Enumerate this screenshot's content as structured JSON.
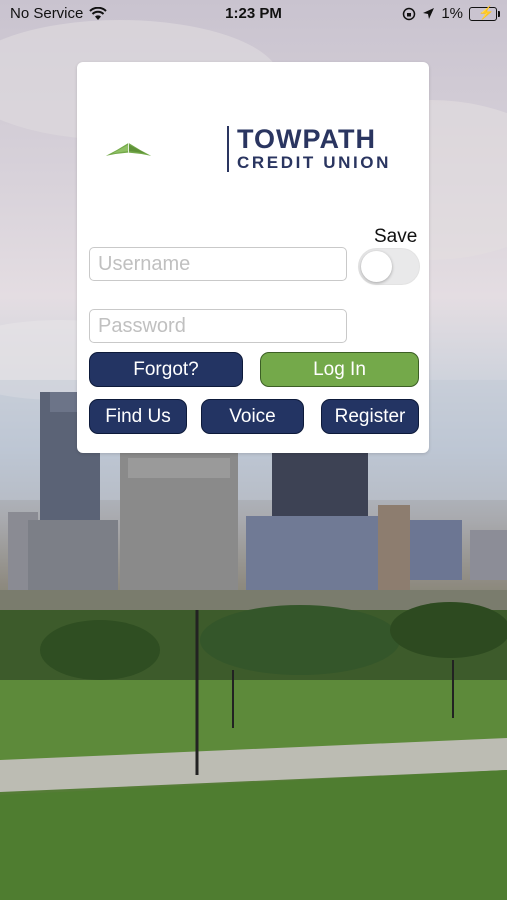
{
  "status_bar": {
    "carrier": "No Service",
    "time": "1:23 PM",
    "battery_percent": "1%",
    "icons": [
      "wifi-icon",
      "orientation-lock-icon",
      "location-arrow-icon",
      "battery-charging-icon"
    ]
  },
  "logo": {
    "line1": "TOWPATH",
    "line2": "CREDIT UNION",
    "brand_navy": "#2a3560",
    "brand_green": "#74a94a"
  },
  "login": {
    "save_label": "Save",
    "save_enabled": false,
    "username_placeholder": "Username",
    "username_value": "",
    "password_placeholder": "Password",
    "password_value": ""
  },
  "buttons": {
    "forgot": "Forgot?",
    "login": "Log In",
    "find_us": "Find Us",
    "voice": "Voice",
    "register": "Register"
  },
  "colors": {
    "button_navy": "#233463",
    "button_green": "#74a94a"
  }
}
